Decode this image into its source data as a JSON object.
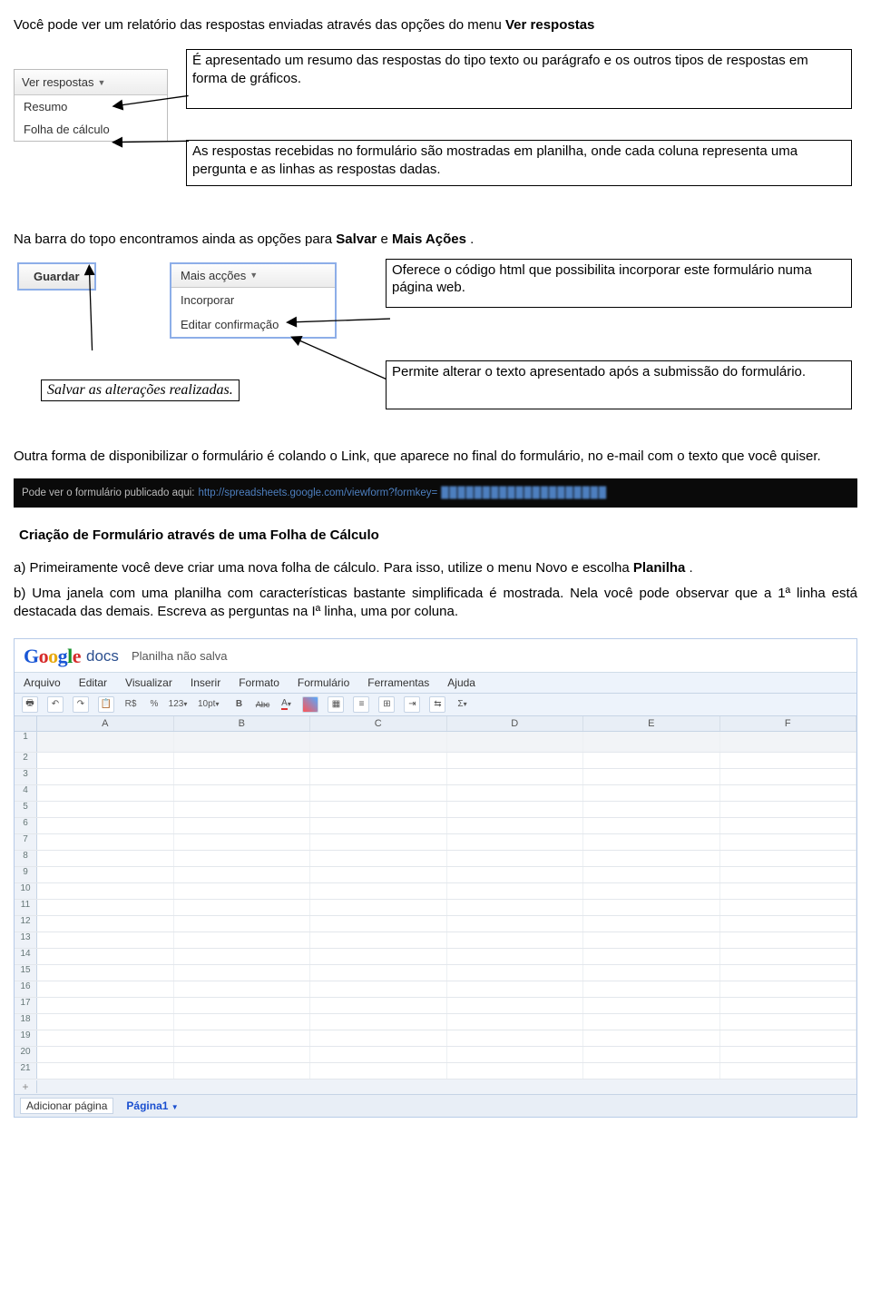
{
  "intro": {
    "p1_pre": "Você pode ver um relatório das respostas enviadas através das opções do menu ",
    "p1_bold": "Ver respostas"
  },
  "sec1": {
    "dropdown": {
      "button": "Ver respostas",
      "item1": "Resumo",
      "item2": "Folha de cálculo"
    },
    "box1": "É apresentado um resumo das respostas do tipo texto ou parágrafo e os outros tipos de respostas em forma de gráficos.",
    "box2": "As respostas recebidas no formulário são mostradas em planilha,  onde cada coluna representa uma pergunta e as linhas as respostas dadas."
  },
  "mid_para": {
    "pre": "Na barra do topo encontramos ainda as opções para ",
    "b1": "Salvar",
    "mid": " e ",
    "b2": "Mais Ações",
    "end": "."
  },
  "sec2": {
    "guardar": "Guardar",
    "mais_btn": "Mais acções",
    "mais_item1": "Incorporar",
    "mais_item2": "Editar confirmação",
    "box_incorporar": "Oferece o código html que possibilita incorporar este formulário numa página web.",
    "box_editar": "Permite alterar o texto apresentado após a submissão do formulário.",
    "box_salvar": "Salvar as alterações realizadas."
  },
  "link_para": "Outra forma de disponibilizar o formulário é colando o Link, que aparece no final do formulário, no e-mail com o texto que você quiser.",
  "linkbar": {
    "label": "Pode ver o formulário publicado aqui:",
    "url": "http://spreadsheets.google.com/viewform?formkey="
  },
  "subhead": "Criação de Formulário através de uma Folha de Cálculo",
  "step_a": {
    "pre": "a) Primeiramente você deve criar uma nova folha de cálculo. Para isso, utilize o menu Novo e escolha ",
    "bold": "Planilha",
    "post": "."
  },
  "step_b": "b) Uma janela com uma planilha com características bastante simplificada é mostrada. Nela você pode observar que a 1ª linha está destacada das demais. Escreva as perguntas na Iª linha, uma por coluna.",
  "gdocs": {
    "brand_docs": "docs",
    "untitled": "Planilha não salva",
    "menu": [
      "Arquivo",
      "Editar",
      "Visualizar",
      "Inserir",
      "Formato",
      "Formulário",
      "Ferramentas",
      "Ajuda"
    ],
    "toolbar": {
      "currency": "R$",
      "percent": "%",
      "numfmt": "123",
      "fontsize": "10pt",
      "bold": "B",
      "strike": "Abc",
      "fontcolor": "A",
      "sigma": "Σ"
    },
    "cols": [
      "A",
      "B",
      "C",
      "D",
      "E",
      "F"
    ],
    "rows": 21,
    "footer_add": "Adicionar página",
    "footer_page": "Página1"
  }
}
